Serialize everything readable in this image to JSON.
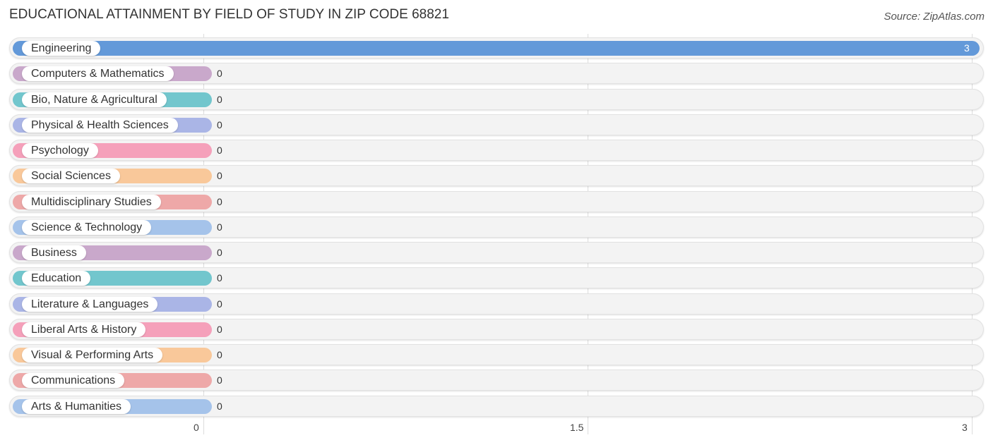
{
  "header": {
    "title": "EDUCATIONAL ATTAINMENT BY FIELD OF STUDY IN ZIP CODE 68821",
    "source": "Source: ZipAtlas.com"
  },
  "chart_data": {
    "type": "bar",
    "orientation": "horizontal",
    "title": "EDUCATIONAL ATTAINMENT BY FIELD OF STUDY IN ZIP CODE 68821",
    "xlabel": "",
    "ylabel": "",
    "xlim": [
      0,
      3
    ],
    "grid": true,
    "x_ticks": [
      "0",
      "1.5",
      "3"
    ],
    "x_tick_values": [
      0,
      1.5,
      3
    ],
    "categories": [
      "Engineering",
      "Computers & Mathematics",
      "Bio, Nature & Agricultural",
      "Physical & Health Sciences",
      "Psychology",
      "Social Sciences",
      "Multidisciplinary Studies",
      "Science & Technology",
      "Business",
      "Education",
      "Literature & Languages",
      "Liberal Arts & History",
      "Visual & Performing Arts",
      "Communications",
      "Arts & Humanities"
    ],
    "values": [
      3,
      0,
      0,
      0,
      0,
      0,
      0,
      0,
      0,
      0,
      0,
      0,
      0,
      0,
      0
    ],
    "value_labels": [
      "3",
      "0",
      "0",
      "0",
      "0",
      "0",
      "0",
      "0",
      "0",
      "0",
      "0",
      "0",
      "0",
      "0",
      "0"
    ],
    "colors": [
      "#6399d9",
      "#c9a8cb",
      "#72c6cd",
      "#aab5e6",
      "#f5a0ba",
      "#f9c89a",
      "#eea8a8",
      "#a5c3ea",
      "#c9a8cb",
      "#72c6cd",
      "#aab5e6",
      "#f5a0ba",
      "#f9c89a",
      "#eea8a8",
      "#a5c3ea"
    ]
  }
}
